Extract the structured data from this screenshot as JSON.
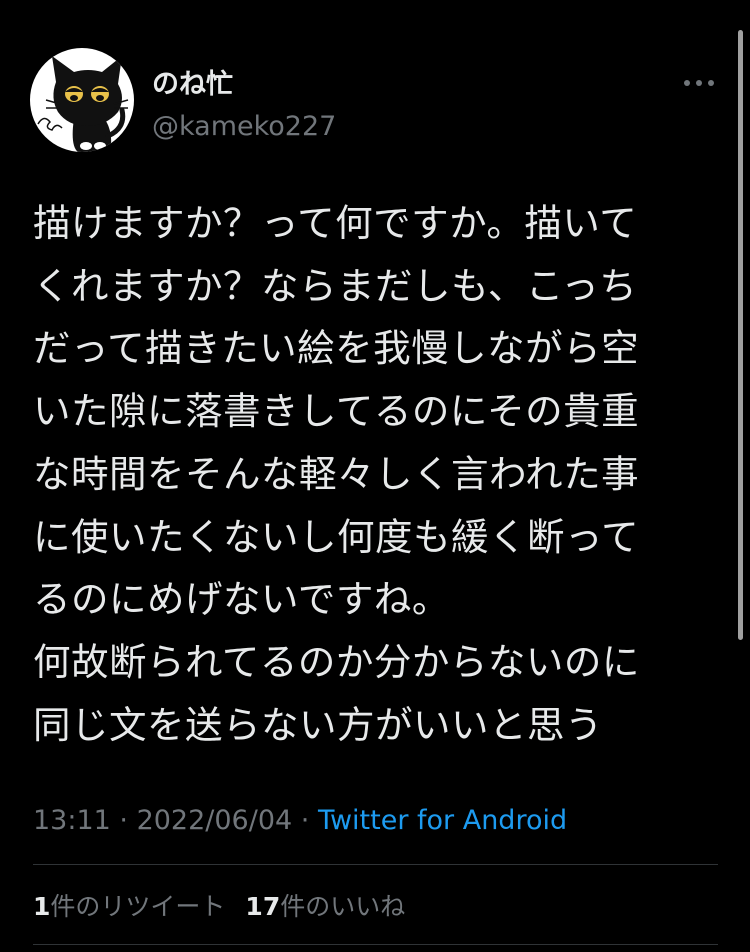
{
  "user": {
    "display_name": "のね忙",
    "handle": "@kameko227",
    "avatar_icon": "black-cat-avatar-icon"
  },
  "more_icon": "more-options-icon",
  "tweet": {
    "text": "描けますか？って何ですか。描いて\nくれますか？ならまだしも、こっち\nだって描きたい絵を我慢しながら空\nいた隙に落書きしてるのにその貴重\nな時間をそんな軽々しく言われた事\nに使いたくないし何度も緩く断って\nるのにめげないですね。\n何故断られてるのか分からないのに\n同じ文を送らない方がいいと思う"
  },
  "meta": {
    "time": "13:11",
    "separator": " · ",
    "date": "2022/06/04",
    "source": "Twitter for Android"
  },
  "stats": {
    "retweets_count": "1",
    "retweets_label": "件のリツイート",
    "likes_count": "17",
    "likes_label": "件のいいね"
  },
  "colors": {
    "background": "#000000",
    "text": "#e7e9ea",
    "secondary": "#71767b",
    "link": "#1d9bf0",
    "divider": "#2f3336"
  }
}
